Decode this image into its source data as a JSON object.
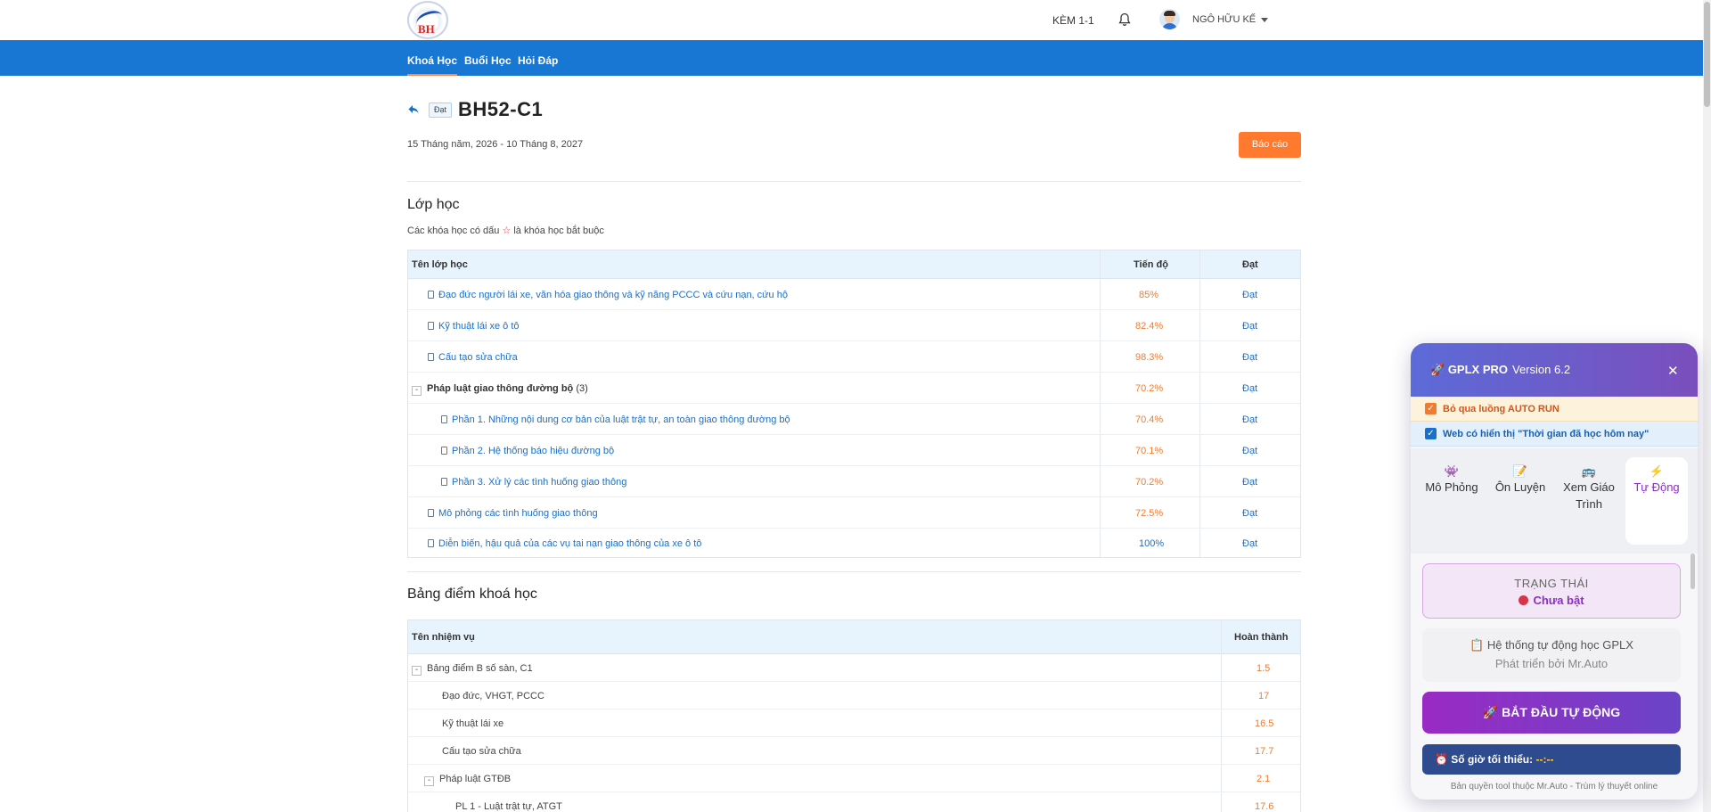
{
  "header": {
    "kem_label": "KÈM 1-1",
    "username": "NGÔ HỮU KẾ",
    "logo_text": "BH"
  },
  "nav": {
    "items": [
      {
        "label": "Khoá Học",
        "active": true
      },
      {
        "label": "Buổi Học",
        "active": false
      },
      {
        "label": "Hỏi Đáp",
        "active": false
      }
    ]
  },
  "course": {
    "status_tag": "Đạt",
    "title": "BH52-C1",
    "date_range": "15 Tháng năm, 2026 - 10 Tháng 8, 2027",
    "report_label": "Báo cáo"
  },
  "classes": {
    "title": "Lớp học",
    "note_before": "Các khóa học có dấu",
    "note_star": "☆",
    "note_after": "là khóa học bắt buộc",
    "headers": {
      "name": "Tên lớp học",
      "progress": "Tiến độ",
      "result": "Đạt"
    },
    "rows": [
      {
        "name": "Đạo đức người lái xe, văn hóa giao thông và kỹ năng PCCC và cứu nạn, cứu hộ",
        "progress": "85%",
        "result": "Đạt"
      },
      {
        "name": "Kỹ thuật lái xe ô tô",
        "progress": "82.4%",
        "result": "Đạt"
      },
      {
        "name": "Cấu tạo sửa chữa",
        "progress": "98.3%",
        "result": "Đạt"
      },
      {
        "name": "Pháp luật giao thông đường bộ",
        "count": "(3)",
        "progress": "70.2%",
        "result": "Đạt"
      },
      {
        "name": "Phần 1. Những nội dung cơ bản của luật trật tự, an toàn giao thông đường bộ",
        "progress": "70.4%",
        "result": "Đạt"
      },
      {
        "name": "Phần 2. Hệ thống báo hiệu đường bộ",
        "progress": "70.1%",
        "result": "Đạt"
      },
      {
        "name": "Phần 3. Xử lý các tình huống giao thông",
        "progress": "70.2%",
        "result": "Đạt"
      },
      {
        "name": "Mô phỏng các tình huống giao thông",
        "progress": "72.5%",
        "result": "Đạt"
      },
      {
        "name": "Diễn biến, hậu quả của các vụ tai nạn giao thông của xe ô tô",
        "progress": "100%",
        "result": "Đạt"
      }
    ]
  },
  "scores": {
    "title": "Bảng điểm khoá học",
    "headers": {
      "name": "Tên nhiệm vụ",
      "done": "Hoàn thành"
    },
    "rows": [
      {
        "name": "Bảng điểm B số sàn, C1",
        "value": "1.5"
      },
      {
        "name": "Đạo đức, VHGT, PCCC",
        "value": "17"
      },
      {
        "name": "Kỹ thuật lái xe",
        "value": "16.5"
      },
      {
        "name": "Cấu tạo sửa chữa",
        "value": "17.7"
      },
      {
        "name": "Pháp luật GTĐB",
        "value": "2.1"
      },
      {
        "name": "PL 1 - Luật trật tự, ATGT",
        "value": "17.6"
      }
    ]
  },
  "panel": {
    "title": "GPLX PRO",
    "version": "Version 6.2",
    "close": "✕",
    "option1": "Bỏ qua luồng AUTO RUN",
    "option2": "Web có hiển thị \"Thời gian đã học hôm nay\"",
    "tabs": [
      {
        "icon": "👾",
        "label": "Mô Phỏng"
      },
      {
        "icon": "📝",
        "label": "Ôn Luyện"
      },
      {
        "icon": "🚌",
        "label": "Xem Giáo Trình"
      },
      {
        "icon": "⚡",
        "label": "Tự Động"
      }
    ],
    "status_caption": "TRẠNG THÁI",
    "status_value": "Chưa bật",
    "info_line1": "📋 Hệ thống tự động học GPLX",
    "info_line2": "Phát triển bởi Mr.Auto",
    "start_label": "🚀   BẮT ĐẦU TỰ ĐỘNG",
    "min_hours_label": "⏰ Số giờ tối thiểu:",
    "min_hours_value": "--:--",
    "copyright": "Bản quyền tool thuộc Mr.Auto - Trùm lý thuyết online"
  },
  "colors": {
    "nav_blue": "#1877d2",
    "report_orange": "#ff7a2e",
    "progress_orange": "#f07c32",
    "link_blue": "#1a6fc9",
    "panel_purple": "#7a4fbd"
  }
}
